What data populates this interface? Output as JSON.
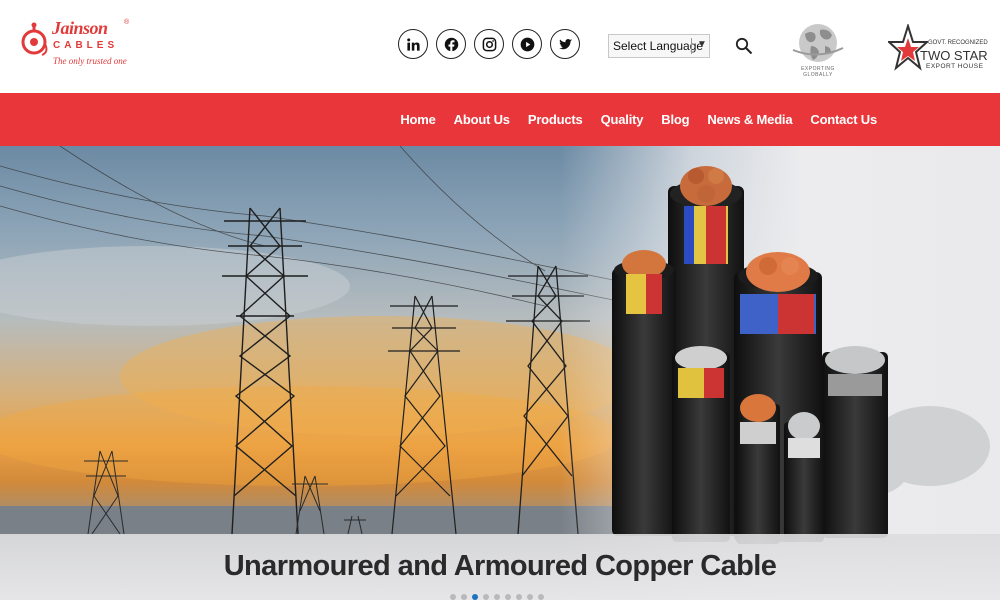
{
  "brand": {
    "name": "Jainson",
    "reg": "®",
    "sub": "CABLES",
    "tagline": "The only trusted one"
  },
  "socials": [
    {
      "icon": "linkedin-icon",
      "label": "in"
    },
    {
      "icon": "facebook-icon"
    },
    {
      "icon": "instagram-icon"
    },
    {
      "icon": "youtube-icon"
    },
    {
      "icon": "twitter-icon"
    }
  ],
  "language": {
    "selected": "Select Language"
  },
  "badges": {
    "globe_caption": "EXPORTING GLOBALLY",
    "star_line1": "GOVT. RECOGNIZED",
    "star_line2": "TWO STAR",
    "star_line3": "EXPORT HOUSE"
  },
  "nav": [
    "Home",
    "About Us",
    "Products",
    "Quality",
    "Blog",
    "News & Media",
    "Contact Us"
  ],
  "hero": {
    "caption": "Unarmoured and Armoured Copper Cable",
    "slide_count": 9,
    "active_slide": 3
  },
  "colors": {
    "brand_red": "#e8363a",
    "active_dot": "#1e73be"
  }
}
